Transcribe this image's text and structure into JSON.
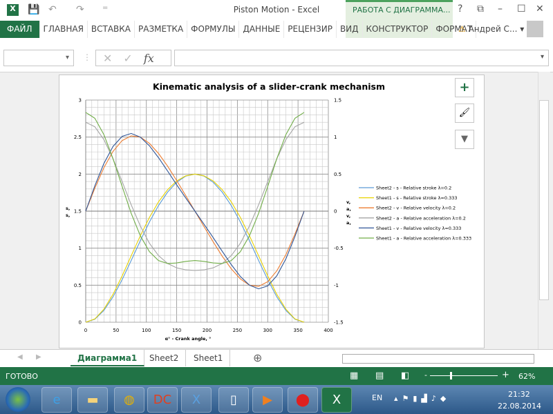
{
  "window": {
    "title": "Piston Motion - Excel",
    "context_tab": "РАБОТА С ДИАГРАММА...",
    "help": "?",
    "restore": "⧉",
    "minimize": "–",
    "maximize": "☐",
    "close": "✕"
  },
  "quick_access": {
    "excel_icon": "X",
    "save": "💾",
    "undo": "↶",
    "redo": "↷",
    "customize": "="
  },
  "ribbon": {
    "tabs": [
      "ФАЙЛ",
      "ГЛАВНАЯ",
      "ВСТАВКА",
      "РАЗМЕТКА",
      "ФОРМУЛЫ",
      "ДАННЫЕ",
      "РЕЦЕНЗИР",
      "ВИД",
      "КОНСТРУКТОР",
      "ФОРМАТ"
    ],
    "user": "Андрей С...",
    "warning_icon": "⚠"
  },
  "formula_bar": {
    "name_box": "",
    "cancel": "✕",
    "enter": "✓",
    "fx": "fx",
    "value": ""
  },
  "chart_buttons": {
    "add": "+",
    "style": "🖌",
    "filter": "▼"
  },
  "sheets": {
    "tabs": [
      "Диаграмма1",
      "Sheet2",
      "Sheet1"
    ],
    "active": "Диаграмма1",
    "add": "⊕"
  },
  "status": {
    "text": "ГОТОВО",
    "zoom": "62%",
    "zoom_level": 62,
    "minus": "-",
    "plus": "+"
  },
  "taskbar": {
    "lang": "EN",
    "time": "21:32",
    "date": "22.08.2014"
  },
  "chart_data": {
    "type": "line",
    "title": "Kinematic analysis of a slider-crank mechanism",
    "xlabel": "α° - Crank angle, °",
    "ylabel_left": [
      "s,",
      "s,"
    ],
    "ylabel_right": [
      "v,",
      "a,",
      "v,",
      "a,"
    ],
    "xlim": [
      0,
      400
    ],
    "ylim_left": [
      0,
      3
    ],
    "ylim_right": [
      -1.5,
      1.5
    ],
    "x_ticks": [
      "0",
      "50",
      "100",
      "150",
      "200",
      "250",
      "300",
      "350",
      "400"
    ],
    "y_ticks_left": [
      "3",
      "2.5",
      "2",
      "1.5",
      "1",
      "0.5",
      "0"
    ],
    "y_ticks_right": [
      "1.5",
      "1",
      "0.5",
      "0",
      "-0.5",
      "-1",
      "-1.5"
    ],
    "grid": true,
    "legend": "right",
    "x": [
      0,
      15,
      30,
      45,
      60,
      75,
      90,
      105,
      120,
      135,
      150,
      165,
      180,
      195,
      210,
      225,
      240,
      255,
      270,
      285,
      300,
      315,
      330,
      345,
      360
    ],
    "series": [
      {
        "name": "Sheet2 -  s - Relative stroke λ=0.2",
        "axis": "left",
        "color": "#5b9bd5",
        "values": [
          0,
          0.041,
          0.159,
          0.343,
          0.575,
          0.834,
          1.1,
          1.352,
          1.575,
          1.757,
          1.891,
          1.973,
          2,
          1.973,
          1.891,
          1.757,
          1.575,
          1.352,
          1.1,
          0.834,
          0.575,
          0.343,
          0.159,
          0.041,
          0
        ]
      },
      {
        "name": "Sheet1 -  s - Relative stroke λ=0.333",
        "axis": "left",
        "color": "#e8d200",
        "values": [
          0,
          0.045,
          0.176,
          0.376,
          0.625,
          0.897,
          1.167,
          1.414,
          1.625,
          1.79,
          1.908,
          1.977,
          2,
          1.977,
          1.908,
          1.79,
          1.625,
          1.414,
          1.167,
          0.897,
          0.625,
          0.376,
          0.176,
          0.045,
          0
        ]
      },
      {
        "name": "Sheet2 -  v - Relative velocity λ=0.2",
        "axis": "right",
        "color": "#ed7d31",
        "values": [
          0,
          0.309,
          0.587,
          0.807,
          0.953,
          1.016,
          1,
          0.916,
          0.779,
          0.607,
          0.413,
          0.209,
          0,
          -0.209,
          -0.413,
          -0.607,
          -0.779,
          -0.916,
          -1,
          -1.016,
          -0.953,
          -0.807,
          -0.587,
          -0.309,
          0
        ]
      },
      {
        "name": "Sheet2 -  a - Relative acceleration λ=0.2",
        "axis": "right",
        "color": "#a5a5a5",
        "values": [
          1.2,
          1.139,
          0.966,
          0.707,
          0.4,
          0.086,
          -0.2,
          -0.432,
          -0.6,
          -0.707,
          -0.766,
          -0.793,
          -0.8,
          -0.793,
          -0.766,
          -0.707,
          -0.6,
          -0.432,
          -0.2,
          0.086,
          0.4,
          0.707,
          0.966,
          1.139,
          1.2
        ]
      },
      {
        "name": "Sheet1 -  v - Relative velocity λ=0.333",
        "axis": "right",
        "color": "#2f5597",
        "values": [
          0,
          0.342,
          0.644,
          0.874,
          1.01,
          1.049,
          1,
          0.883,
          0.722,
          0.541,
          0.356,
          0.176,
          0,
          -0.176,
          -0.356,
          -0.541,
          -0.722,
          -0.883,
          -1,
          -1.049,
          -1.01,
          -0.874,
          -0.644,
          -0.342,
          0
        ]
      },
      {
        "name": "Sheet1 -  a - Relative acceleration λ=0.333",
        "axis": "right",
        "color": "#70ad47",
        "values": [
          1.333,
          1.254,
          1.033,
          0.707,
          0.334,
          -0.03,
          -0.333,
          -0.547,
          -0.667,
          -0.707,
          -0.7,
          -0.678,
          -0.667,
          -0.678,
          -0.7,
          -0.707,
          -0.667,
          -0.547,
          -0.333,
          -0.03,
          0.334,
          0.707,
          1.033,
          1.254,
          1.333
        ]
      }
    ]
  }
}
